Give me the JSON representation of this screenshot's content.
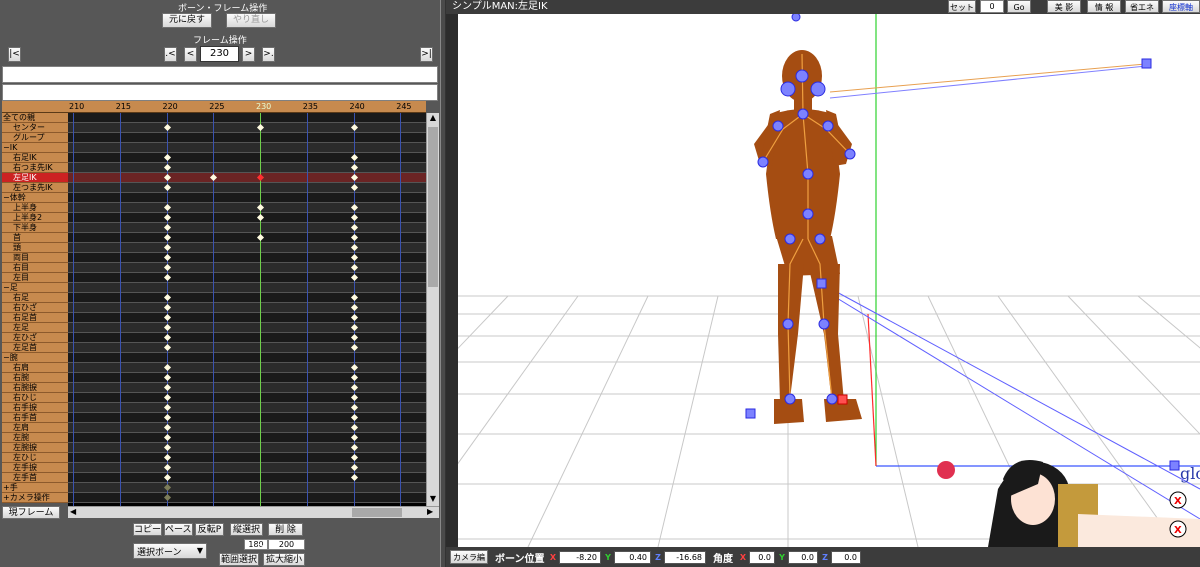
{
  "left": {
    "title": "ボーン・フレーム操作",
    "undo_label": "元に戻す",
    "redo_label": "やり直し",
    "frame_op_label": "フレーム操作",
    "first_label": "|<",
    "prev_key_label": ".<",
    "prev_label": "<",
    "current_frame": "230",
    "next_label": ">",
    "next_key_label": ">.",
    "last_label": ">|",
    "ruler_ticks": [
      "210",
      "215",
      "220",
      "225",
      "230",
      "235",
      "240",
      "245"
    ],
    "rows": [
      {
        "label": "全ての親",
        "group": true
      },
      {
        "label": "センター",
        "group": false
      },
      {
        "label": "グループ",
        "group": false
      },
      {
        "label": "−IK",
        "group": true
      },
      {
        "label": "右足IK",
        "group": false
      },
      {
        "label": "右つま先IK",
        "group": false
      },
      {
        "label": "左足IK",
        "group": false,
        "selected": true
      },
      {
        "label": "左つま先IK",
        "group": false
      },
      {
        "label": "−体幹",
        "group": true
      },
      {
        "label": "上半身",
        "group": false
      },
      {
        "label": "上半身2",
        "group": false
      },
      {
        "label": "下半身",
        "group": false
      },
      {
        "label": "首",
        "group": false
      },
      {
        "label": "頭",
        "group": false
      },
      {
        "label": "両目",
        "group": false
      },
      {
        "label": "右目",
        "group": false
      },
      {
        "label": "左目",
        "group": false
      },
      {
        "label": "−足",
        "group": true
      },
      {
        "label": "右足",
        "group": false
      },
      {
        "label": "右ひざ",
        "group": false
      },
      {
        "label": "右足首",
        "group": false
      },
      {
        "label": "左足",
        "group": false
      },
      {
        "label": "左ひざ",
        "group": false
      },
      {
        "label": "左足首",
        "group": false
      },
      {
        "label": "−腕",
        "group": true
      },
      {
        "label": "右肩",
        "group": false
      },
      {
        "label": "右腕",
        "group": false
      },
      {
        "label": "右腕捩",
        "group": false
      },
      {
        "label": "右ひじ",
        "group": false
      },
      {
        "label": "右手捩",
        "group": false
      },
      {
        "label": "右手首",
        "group": false
      },
      {
        "label": "左肩",
        "group": false
      },
      {
        "label": "左腕",
        "group": false
      },
      {
        "label": "左腕捩",
        "group": false
      },
      {
        "label": "左ひじ",
        "group": false
      },
      {
        "label": "左手捩",
        "group": false
      },
      {
        "label": "左手首",
        "group": false
      },
      {
        "label": "+手",
        "group": true
      },
      {
        "label": "+カメラ操作",
        "group": true
      }
    ],
    "current_frame_btn": "現フレーム",
    "copy_label": "コピー",
    "paste_label": "ペースト",
    "reverse_paste_label": "反転P",
    "vertical_select_label": "縦選択",
    "delete_label": "削 除",
    "select_mode": "選択ボーン",
    "range_from": "180",
    "range_tilde": "〜",
    "range_to": "200",
    "range_select_label": "範囲選択",
    "zoom_label": "拡大縮小"
  },
  "viewport": {
    "title": "シンプルMAN:左足IK",
    "set_label": "セット",
    "frame_value": "0",
    "go_label": "Go",
    "beauty_label": "美 影",
    "info_label": "情 報",
    "energy_label": "省エネ",
    "coord_label": "座標軸",
    "gloss_text": "glo"
  },
  "bottom": {
    "camera_edit_label": "カメラ編",
    "bone_pos_label": "ボーン位置",
    "pos_x": "-8.20",
    "pos_y": "0.40",
    "pos_z": "-16.68",
    "angle_label": "角度",
    "ang_x": "0.0",
    "ang_y": "0.0",
    "ang_z": "0.0",
    "x_tag": "X",
    "y_tag": "Y",
    "z_tag": "Z"
  }
}
